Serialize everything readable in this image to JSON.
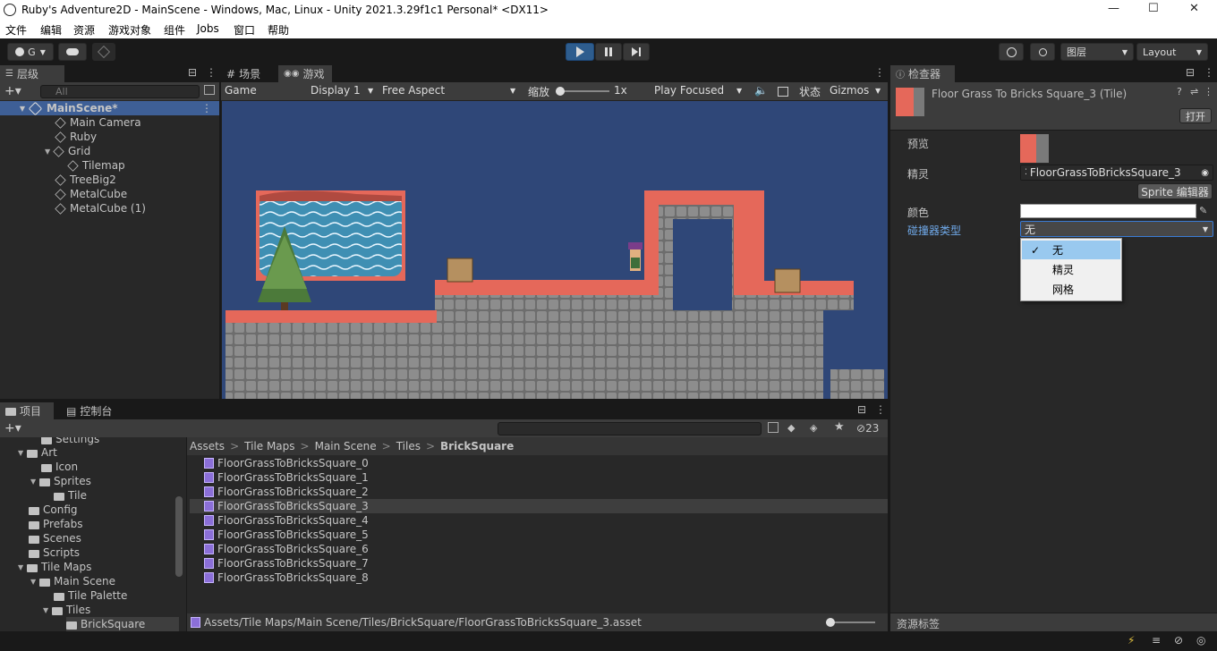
{
  "window": {
    "title": "Ruby's Adventure2D - MainScene - Windows, Mac, Linux - Unity 2021.3.29f1c1 Personal* <DX11>",
    "minimize": "—",
    "maximize": "☐",
    "close": "✕"
  },
  "menu": [
    "文件",
    "编辑",
    "资源",
    "游戏对象",
    "组件",
    "Jobs",
    "窗口",
    "帮助"
  ],
  "toolbar": {
    "account": "G",
    "layers": "图层",
    "layout": "Layout"
  },
  "hierarchy": {
    "tab": "层级",
    "search_placeholder": "All",
    "scene": "MainScene*",
    "items": [
      "Main Camera",
      "Ruby",
      "Grid",
      "Tilemap",
      "TreeBig2",
      "MetalCube",
      "MetalCube (1)"
    ]
  },
  "scene_tabs": {
    "scene": "场景",
    "game": "游戏"
  },
  "game_bar": {
    "mode": "Game",
    "display": "Display 1",
    "aspect": "Free Aspect",
    "scale_label": "缩放",
    "scale_value": "1x",
    "play_mode": "Play Focused",
    "stats": "状态",
    "gizmos": "Gizmos"
  },
  "inspector": {
    "tab": "检查器",
    "object_name": "Floor Grass To Bricks Square_3 (Tile)",
    "open_button": "打开",
    "preview_label": "预览",
    "sprite_label": "精灵",
    "sprite_value": "FloorGrassToBricksSquare_3",
    "sprite_editor_button": "Sprite 编辑器",
    "color_label": "颜色",
    "collider_label": "碰撞器类型",
    "collider_value": "无",
    "collider_options": [
      "无",
      "精灵",
      "网格"
    ],
    "asset_labels": "资源标签"
  },
  "project": {
    "tab": "项目",
    "console_tab": "控制台",
    "hidden_count": "23",
    "breadcrumb": [
      "Assets",
      "Tile Maps",
      "Main Scene",
      "Tiles",
      "BrickSquare"
    ],
    "tree": [
      "Settings",
      "Art",
      "Icon",
      "Sprites",
      "Tile",
      "Config",
      "Prefabs",
      "Scenes",
      "Scripts",
      "Tile Maps",
      "Main Scene",
      "Tile Palette",
      "Tiles",
      "BrickSquare"
    ],
    "files": [
      "FloorGrassToBricksSquare_0",
      "FloorGrassToBricksSquare_1",
      "FloorGrassToBricksSquare_2",
      "FloorGrassToBricksSquare_3",
      "FloorGrassToBricksSquare_4",
      "FloorGrassToBricksSquare_5",
      "FloorGrassToBricksSquare_6",
      "FloorGrassToBricksSquare_7",
      "FloorGrassToBricksSquare_8"
    ],
    "status_path": "Assets/Tile Maps/Main Scene/Tiles/BrickSquare/FloorGrassToBricksSquare_3.asset"
  },
  "colors": {
    "accent_play": "#2e5d8e",
    "selection": "#3e5f96",
    "dropdown_highlight": "#99c9ef",
    "game_bg": "#2f4778",
    "brick_red": "#e5685a"
  },
  "icons": [
    "unity-logo-icon",
    "account-icon",
    "cloud-icon",
    "collab-icon",
    "play-icon",
    "pause-icon",
    "step-icon",
    "history-icon",
    "search-icon",
    "plus-icon",
    "lock-icon",
    "kebab-icon",
    "cube-icon",
    "folder-icon",
    "tile-asset-icon",
    "help-icon",
    "settings-icon",
    "checkmark-icon",
    "eyedropper-icon"
  ]
}
